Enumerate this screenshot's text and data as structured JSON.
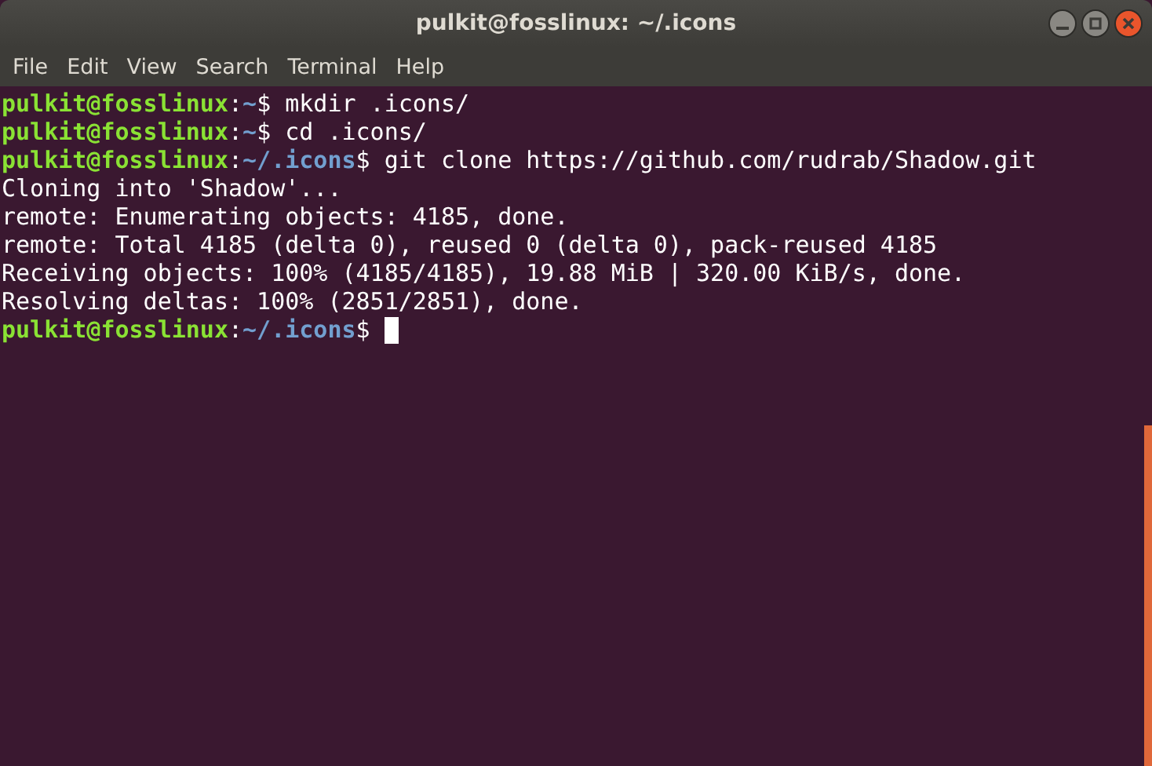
{
  "window": {
    "title": "pulkit@fosslinux: ~/.icons"
  },
  "menu": [
    "File",
    "Edit",
    "View",
    "Search",
    "Terminal",
    "Help"
  ],
  "lines": [
    {
      "kind": "prompt",
      "user": "pulkit@fosslinux",
      "colon": ":",
      "path": "~",
      "dollar": "$",
      "command": " mkdir .icons/"
    },
    {
      "kind": "prompt",
      "user": "pulkit@fosslinux",
      "colon": ":",
      "path": "~",
      "dollar": "$",
      "command": " cd .icons/"
    },
    {
      "kind": "prompt",
      "user": "pulkit@fosslinux",
      "colon": ":",
      "path": "~/.icons",
      "dollar": "$",
      "command": " git clone https://github.com/rudrab/Shadow.git"
    },
    {
      "kind": "output",
      "text": "Cloning into 'Shadow'..."
    },
    {
      "kind": "output",
      "text": "remote: Enumerating objects: 4185, done."
    },
    {
      "kind": "output",
      "text": "remote: Total 4185 (delta 0), reused 0 (delta 0), pack-reused 4185"
    },
    {
      "kind": "output",
      "text": "Receiving objects: 100% (4185/4185), 19.88 MiB | 320.00 KiB/s, done."
    },
    {
      "kind": "output",
      "text": "Resolving deltas: 100% (2851/2851), done."
    },
    {
      "kind": "prompt",
      "user": "pulkit@fosslinux",
      "colon": ":",
      "path": "~/.icons",
      "dollar": "$",
      "cursor": true
    }
  ]
}
